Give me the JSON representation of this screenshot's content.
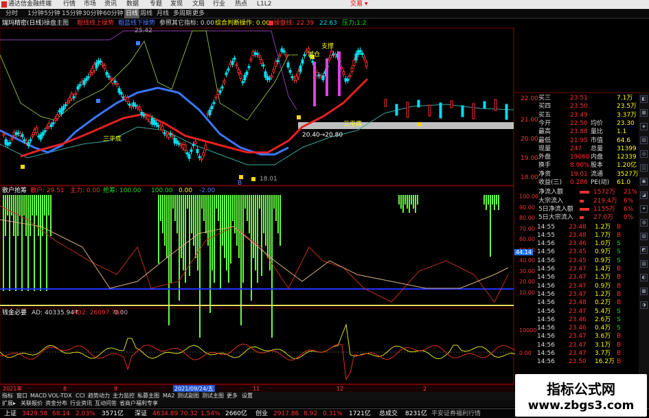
{
  "title_bar": {
    "app": "通达信金融终端",
    "menus": [
      "行情",
      "市场",
      "资讯",
      "数据",
      "专题",
      "发现",
      "文局",
      "行业",
      "热点",
      "L1L2"
    ],
    "trade": "交易 ▾"
  },
  "periods": {
    "items": [
      "分时",
      "1分钟",
      "5分钟",
      "15分钟",
      "30分钟",
      "60分钟",
      "日线",
      "周线",
      "月线",
      "多周期",
      "更多"
    ],
    "selected": "日线"
  },
  "main_indicator": {
    "name": "瑞玛精密(日线)",
    "items": [
      {
        "text": "操盘主图",
        "color": "#dddddd"
      },
      {
        "text": "粗线线上操势",
        "color": "#ff3030"
      },
      {
        "text": "粗蓝线下操势",
        "color": "#5577ff"
      },
      {
        "text": "参照其它指标: 0.00",
        "color": "#dddddd"
      },
      {
        "text": "综合判断操作: 0.00",
        "color": "#ffff00"
      },
      {
        "text": "■操盘线: 22.39",
        "color": "#ff3030"
      },
      {
        "text": "22.63",
        "color": "#00ddee"
      },
      {
        "text": "压力:1:2",
        "color": "#22dd22"
      }
    ]
  },
  "price_axis": [
    "22.00",
    "21.00",
    "20.00",
    "19.00",
    "18.00"
  ],
  "chart_labels": {
    "high": "25.42",
    "low": "18.01",
    "support": "支撑",
    "three_bottom": "三平底",
    "three_bottom_2": "三平底",
    "band": "20.40→20.80",
    "cut_label": "减仓",
    "mark_b": "B"
  },
  "indicator2": {
    "name": "散户抢筹",
    "items": [
      {
        "text": "散户: 29.51",
        "color": "#ff3030"
      },
      {
        "text": "主力: 0.00",
        "color": "#ff3030"
      },
      {
        "text": "抢筹: 100.00",
        "color": "#22dd22"
      },
      {
        "text": "100.00",
        "color": "#22dd22"
      },
      {
        "text": "0.00",
        "color": "#ffff00"
      },
      {
        "text": "-2.00",
        "color": "#5577ff"
      }
    ],
    "axis": [
      "100.00",
      "90.00",
      "80.00",
      "70.00",
      "60.00",
      "50.00",
      "40.00",
      "30.00",
      "20.00",
      "10.00"
    ],
    "current": "44.14"
  },
  "indicator3": {
    "name": "钱金必要",
    "items": [
      {
        "text": "AD: 40335.94↑",
        "color": "#dddddd"
      },
      {
        "text": "AD2: 26097.78↑",
        "color": "#ff3030"
      },
      {
        "text": "0.00",
        "color": "#aaaaaa"
      }
    ],
    "axis": [
      "10000",
      "0.00"
    ]
  },
  "right_panel": {
    "quote_rows": [
      {
        "label": "买三",
        "price": "23.51",
        "vol": "7.1万"
      },
      {
        "label": "买四",
        "price": "23.50",
        "vol": "23.5万"
      },
      {
        "label": "买五",
        "price": "23.49",
        "vol": "3.37万"
      },
      {
        "l1": "今开",
        "v1": "22.50",
        "l2": "均价",
        "v2": "23.30"
      },
      {
        "l1": "最高",
        "v1": "23.88",
        "l2": "量比",
        "v2": "1.1"
      },
      {
        "l1": "最低",
        "v1": "21.95",
        "l2": "市值",
        "v2": "64.6"
      },
      {
        "l1": "现量",
        "v1": "247",
        "l2": "总量",
        "v2": "31399"
      },
      {
        "l1": "外盘",
        "v1": "19060",
        "l2": "内盘",
        "v2": "12339"
      },
      {
        "l1": "换手",
        "v1": "8.90%",
        "l2": "股本",
        "v2": "1.20亿"
      },
      {
        "l1": "净资",
        "v1": "19.01",
        "l2": "流通",
        "v2": "3527万"
      },
      {
        "l1": "收益(三)",
        "v1": "0.286",
        "l2": "PE(动)",
        "v2": "61.0"
      }
    ],
    "flow_rows": [
      {
        "label": "净流入额",
        "val": "1572万",
        "pct": "21%"
      },
      {
        "label": "大宗流入",
        "val": "219.4万",
        "pct": "6%"
      },
      {
        "label": "5日净流入额",
        "val": "1155万",
        "pct": "6%"
      },
      {
        "label": "5日大宗流入",
        "val": "27.0万",
        "pct": "0%"
      }
    ],
    "ticks": [
      {
        "t": "14:55",
        "p": "23.48",
        "v": "1.2万",
        "d": "B"
      },
      {
        "t": "14:55",
        "p": "23.48",
        "v": "1.7万",
        "d": "B"
      },
      {
        "t": "14:56",
        "p": "23.46",
        "v": "1.0万",
        "d": "S"
      },
      {
        "t": "14:56",
        "p": "23.45",
        "v": "0.9万",
        "d": "S"
      },
      {
        "t": "14:56",
        "p": "23.45",
        "v": "0.9万",
        "d": "S"
      },
      {
        "t": "14:56",
        "p": "23.47",
        "v": "1.4万",
        "d": "B"
      },
      {
        "t": "14:56",
        "p": "23.47",
        "v": "1.5万",
        "d": "B"
      },
      {
        "t": "14:56",
        "p": "23.47",
        "v": "0.9万",
        "d": "B"
      },
      {
        "t": "14:56",
        "p": "23.47",
        "v": "1.2万",
        "d": "B"
      },
      {
        "t": "14:56",
        "p": "23.48",
        "v": "0.2万",
        "d": "B"
      },
      {
        "t": "14:56",
        "p": "23.47",
        "v": "5.4万",
        "d": "S"
      },
      {
        "t": "14:56",
        "p": "23.46",
        "v": "2.6万",
        "d": "S"
      },
      {
        "t": "14:56",
        "p": "23.46",
        "v": "0.4万",
        "d": "S"
      },
      {
        "t": "14:56",
        "p": "23.47",
        "v": "3.6万",
        "d": "B"
      },
      {
        "t": "14:56",
        "p": "23.47",
        "v": "3.1万",
        "d": "B"
      },
      {
        "t": "14:56",
        "p": "23.47",
        "v": "3.7万",
        "d": "B"
      },
      {
        "t": "14:56",
        "p": "23.50",
        "v": "16.2万",
        "d": "B"
      }
    ]
  },
  "date_bar": {
    "d1": "2021年",
    "d2": "8",
    "d3": "9",
    "d4": "2021/09/24/五",
    "d5": "11",
    "d6": "12",
    "d7": "2"
  },
  "tabs": [
    "指标",
    "窗口",
    "MACD",
    "VOL-TDX",
    "CCI",
    "趋势动力",
    "主力监控",
    "私募主图",
    "MA2",
    "测试副图",
    "测试主图",
    "更多",
    "设置"
  ],
  "tabs2": [
    "扩展▸",
    "关联报价",
    "资金分布",
    "行业资讯",
    "互动问答",
    "省商户福利专享"
  ],
  "status": {
    "sh": {
      "name": "上证",
      "val": "3429.58",
      "chg": "68.14",
      "pct": "2.03%",
      "amt": "3571亿"
    },
    "sz": {
      "name": "深证",
      "val": "4634.89",
      "chg": "70.32",
      "pct": "1.54%",
      "amt": "2660亿"
    },
    "cy": {
      "name": "创业",
      "val": "2917.86",
      "chg": "8.92",
      "pct": "0.31%",
      "amt": "1721亿"
    },
    "total_label": "总成交",
    "total": "8231亿",
    "broker": "平安证券福利行情"
  },
  "watermark": {
    "line1": "指标公式网",
    "line2": "www.zbgs3.com"
  },
  "colors": {
    "up": "#ff3030",
    "down": "#00e0f0",
    "ma_red": "#e82020",
    "ma_blue": "#3a78ff",
    "indicator_green": "#66ff44"
  }
}
